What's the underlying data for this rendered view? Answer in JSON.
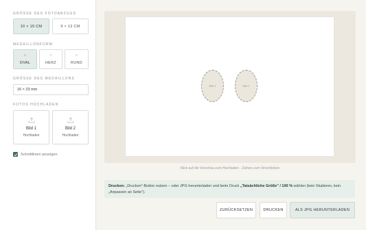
{
  "sidebar": {
    "print_size": {
      "label": "GRÖSSE DES FOTOABZUGS",
      "options": [
        "10 × 15 CM",
        "9 × 13 CM"
      ],
      "selected": "10 × 15 CM"
    },
    "shape": {
      "label": "MEDAILLONFORM",
      "options": [
        {
          "label": "OVAL",
          "icon": "o"
        },
        {
          "label": "HERZ",
          "icon": "o"
        },
        {
          "label": "RUND",
          "icon": "o"
        }
      ],
      "selected": "OVAL"
    },
    "size": {
      "label": "GRÖSSE DES MEDAILLONS",
      "value": "16 × 23 mm"
    },
    "upload": {
      "label": "FOTOS HOCHLADEN",
      "slots": [
        {
          "title": "Bild 1",
          "action": "Hochladen"
        },
        {
          "title": "Bild 2",
          "action": "Hochladen"
        }
      ]
    },
    "cut_lines": {
      "label": "Schnittlinien anzeigen",
      "checked": true
    }
  },
  "preview": {
    "ovals": [
      {
        "label": "Bild 1"
      },
      {
        "label": "Bild 2"
      }
    ],
    "hint": "Klick auf die Vorschau zum Hochladen · Ziehen zum Verschieben"
  },
  "info": {
    "bold_prefix": "Drucken:",
    "text_a": " „Drucken\"-Button nutzen – oder JPG herunterladen und beim Druck ",
    "bold_mid": "„Tatsächliche Größe\" / 100 %",
    "text_b": " wählen (kein Skalieren, kein „Anpassen an Seite\")."
  },
  "buttons": {
    "reset": "ZURÜCKSETZEN",
    "print": "DRUCKEN",
    "download": "ALS JPG HERUNTERLADEN"
  },
  "colors": {
    "accent": "#3f6e5b",
    "active_bg": "#e3ece8",
    "info_bg": "#e6efe9",
    "frame_bg": "#ece8df"
  }
}
